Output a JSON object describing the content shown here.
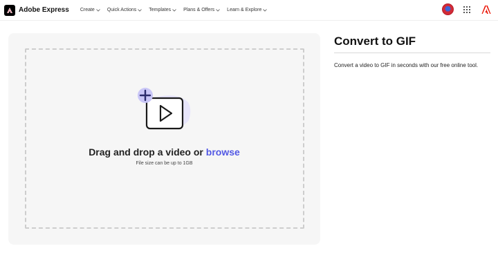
{
  "header": {
    "brand": "Adobe Express",
    "nav": [
      {
        "label": "Create"
      },
      {
        "label": "Quick Actions"
      },
      {
        "label": "Templates"
      },
      {
        "label": "Plans & Offers"
      },
      {
        "label": "Learn & Explore"
      }
    ],
    "icons": [
      "adobe-express-logo-icon",
      "chevron-down-icon",
      "avatar",
      "app-switcher-icon",
      "adobe-logo-icon"
    ]
  },
  "dropzone": {
    "title_prefix": "Drag and drop a video or",
    "browse_label": "browse",
    "subtitle": "File size can be up to 1GB",
    "icon": "video-upload-icon"
  },
  "sidebar": {
    "title": "Convert to GIF",
    "description": "Convert a video to GIF in seconds with our free online tool."
  },
  "colors": {
    "accent": "#5258e4",
    "illustration_bg": "#e7e5fb",
    "adobe_red": "#eb1000"
  }
}
